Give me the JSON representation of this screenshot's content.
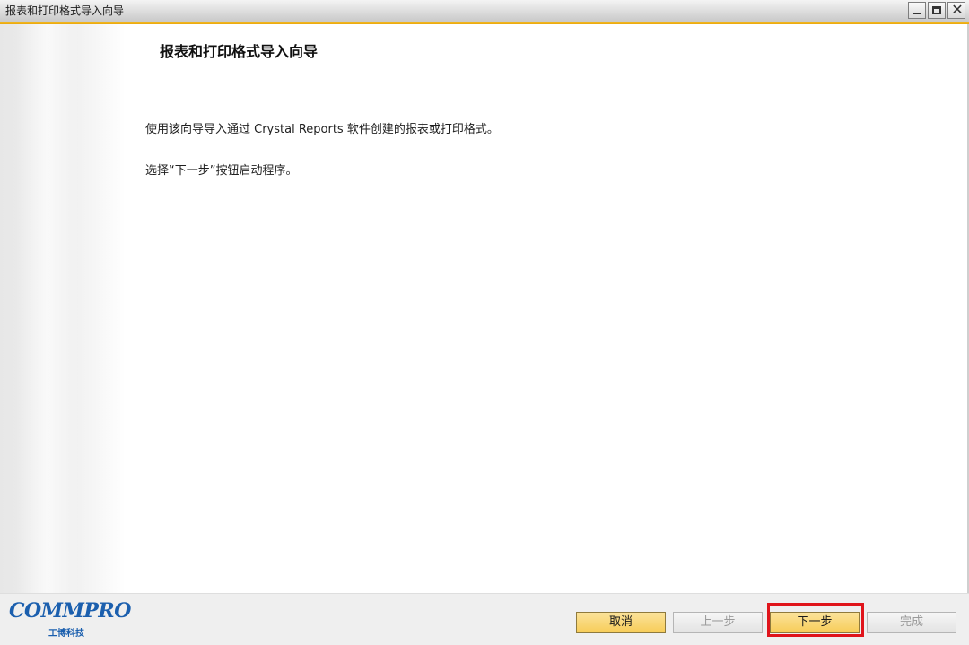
{
  "window": {
    "title": "报表和打印格式导入向导",
    "controls": {
      "minimize_icon": "minimize-icon",
      "maximize_icon": "maximize-icon",
      "close_icon": "close-icon",
      "close_glyph": "✕"
    }
  },
  "main": {
    "heading": "报表和打印格式导入向导",
    "description": "使用该向导导入通过 Crystal Reports 软件创建的报表或打印格式。",
    "instruction": "选择“下一步”按钮启动程序。"
  },
  "footer": {
    "logo": {
      "brand": "OMMPRO",
      "brand_initial": "C",
      "subtitle": "工博科技"
    },
    "buttons": {
      "cancel": "取消",
      "prev": "上一步",
      "next": "下一步",
      "finish": "完成"
    }
  },
  "colors": {
    "accent": "#f7c12c",
    "highlight": "#e0141b",
    "brand": "#1b5fae"
  }
}
